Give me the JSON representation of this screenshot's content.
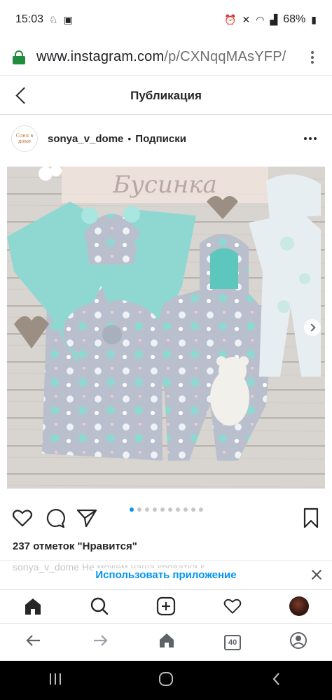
{
  "status_bar": {
    "time": "15:03",
    "battery": "68%"
  },
  "browser": {
    "url_host": "www.instagram.com",
    "url_path": "/p/CXNqqMAsYFP/",
    "tab_count": "40"
  },
  "ig_header": {
    "title": "Публикация"
  },
  "post": {
    "username": "sonya_v_dome",
    "separator": "•",
    "follow_label": "Подписки",
    "avatar_text": "Соня в доме",
    "photo_overlay_text": "Бусинка",
    "carousel_count": 10,
    "carousel_active": 0,
    "likes": "237 отметок \"Нравится\"",
    "caption_partial": "sonya_v_dome Не можем наша кроватка к ..."
  },
  "banner": {
    "open_app_label": "Использовать приложение"
  },
  "icons": {
    "like": "heart-icon",
    "comment": "comment-icon",
    "share": "send-icon",
    "save": "bookmark-icon",
    "home": "home-icon",
    "search": "search-icon",
    "new_post": "plus-square-icon",
    "activity": "heart-icon",
    "profile": "avatar"
  },
  "colors": {
    "accent": "#0095f6",
    "lock": "#1e8e3e",
    "mint": "#8fd8d2",
    "fabric": "#b7bcc8"
  }
}
